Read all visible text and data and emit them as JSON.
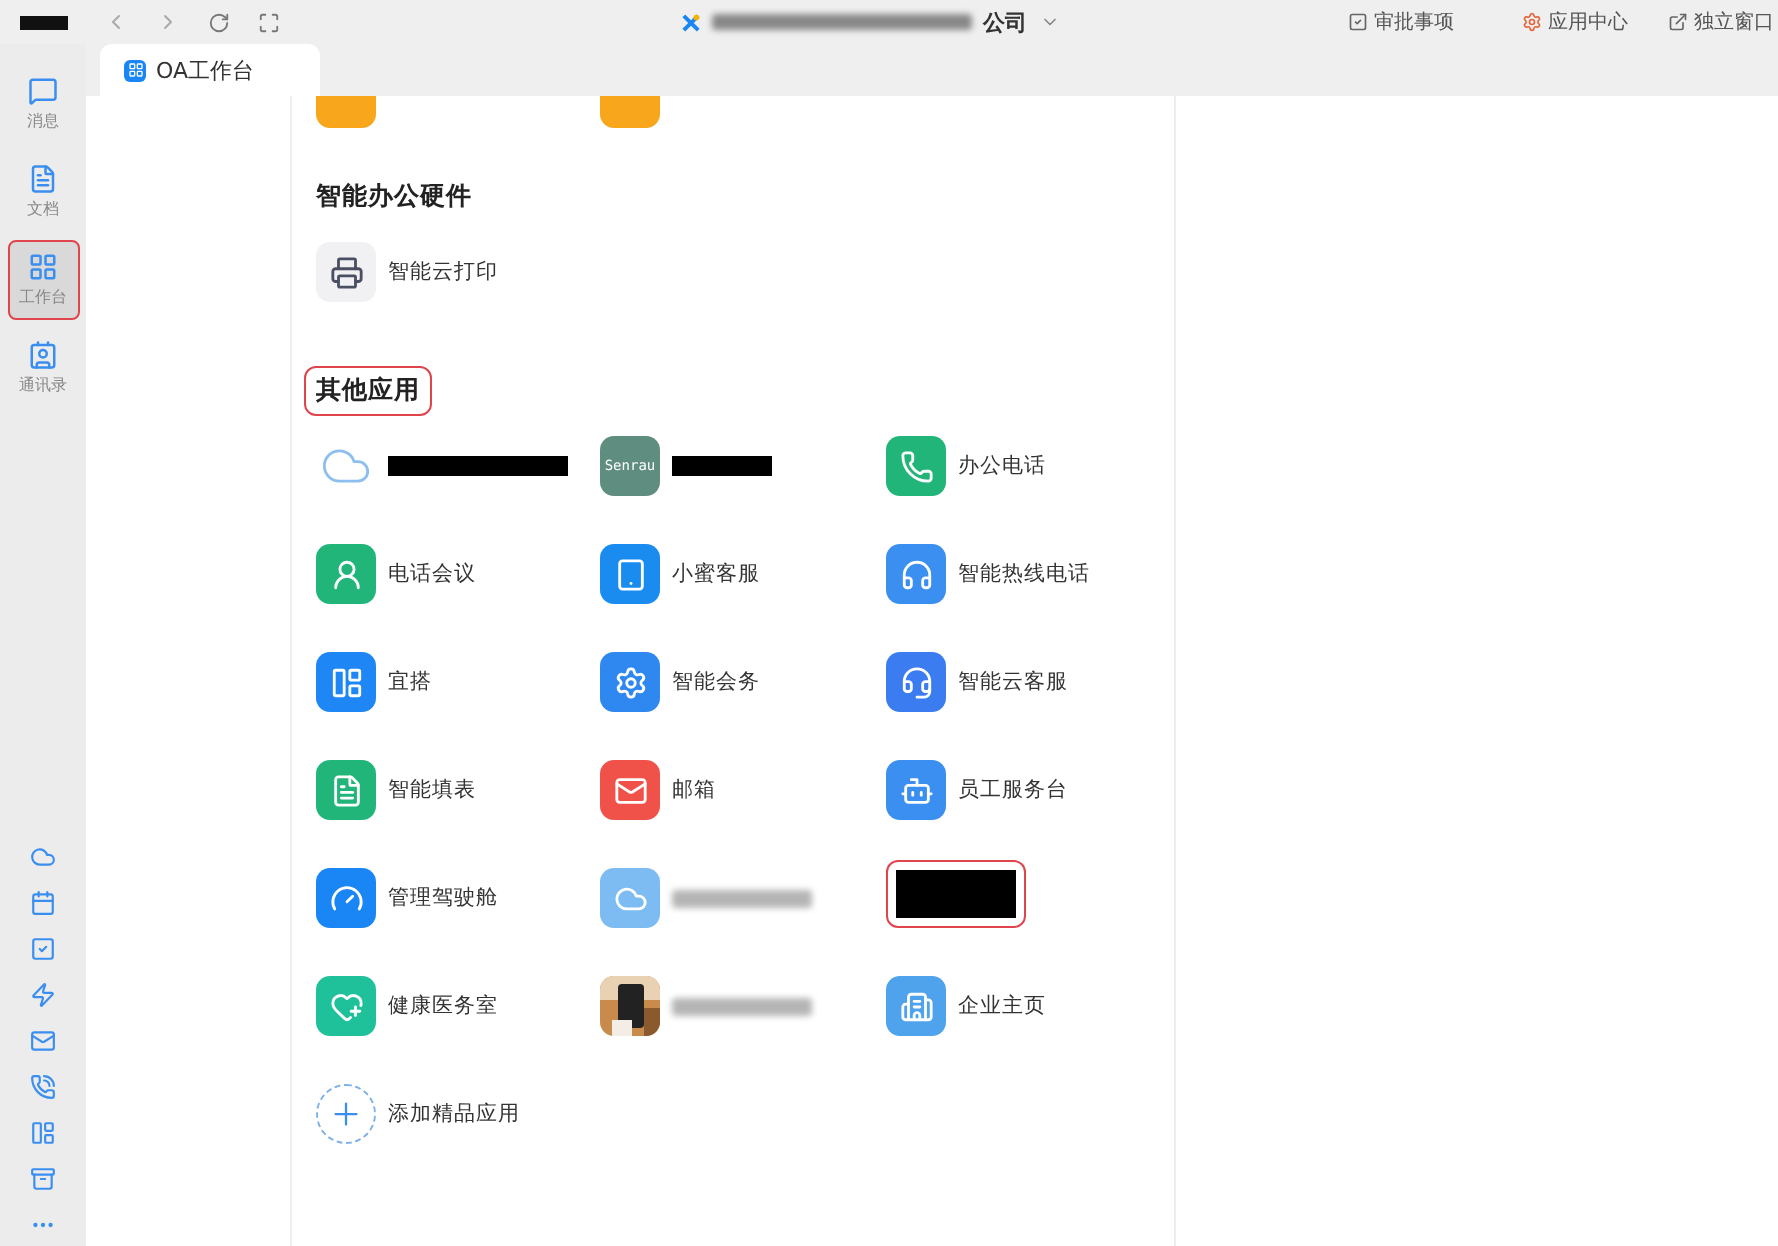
{
  "topbar": {
    "title_suffix": "公司",
    "actions": [
      {
        "label": "审批事项"
      },
      {
        "label": "应用中心"
      },
      {
        "label": "独立窗口"
      }
    ]
  },
  "sidebar": {
    "items": [
      {
        "label": "消息",
        "selected": false
      },
      {
        "label": "文档",
        "selected": false
      },
      {
        "label": "工作台",
        "selected": true
      },
      {
        "label": "通讯录",
        "selected": false
      }
    ]
  },
  "tabs": [
    {
      "label": "OA工作台",
      "selected": true
    }
  ],
  "sections": [
    {
      "title": "智能办公硬件",
      "highlighted": false,
      "apps": [
        {
          "kind": "app",
          "label": "智能云打印"
        }
      ]
    },
    {
      "title": "其他应用",
      "highlighted": true,
      "apps": [
        {
          "kind": "masked"
        },
        {
          "kind": "masked",
          "icon_text": "Senrau"
        },
        {
          "kind": "app",
          "label": "办公电话"
        },
        {
          "kind": "app",
          "label": "电话会议"
        },
        {
          "kind": "app",
          "label": "小蜜客服"
        },
        {
          "kind": "app",
          "label": "智能热线电话"
        },
        {
          "kind": "app",
          "label": "宜搭"
        },
        {
          "kind": "app",
          "label": "智能会务"
        },
        {
          "kind": "app",
          "label": "智能云客服"
        },
        {
          "kind": "app",
          "label": "智能填表"
        },
        {
          "kind": "app",
          "label": "邮箱"
        },
        {
          "kind": "app",
          "label": "员工服务台"
        },
        {
          "kind": "app",
          "label": "管理驾驶舱"
        },
        {
          "kind": "blurred"
        },
        {
          "kind": "redacted"
        },
        {
          "kind": "app",
          "label": "健康医务室"
        },
        {
          "kind": "blurred"
        },
        {
          "kind": "app",
          "label": "企业主页"
        },
        {
          "kind": "add",
          "label": "添加精品应用"
        }
      ]
    }
  ]
}
